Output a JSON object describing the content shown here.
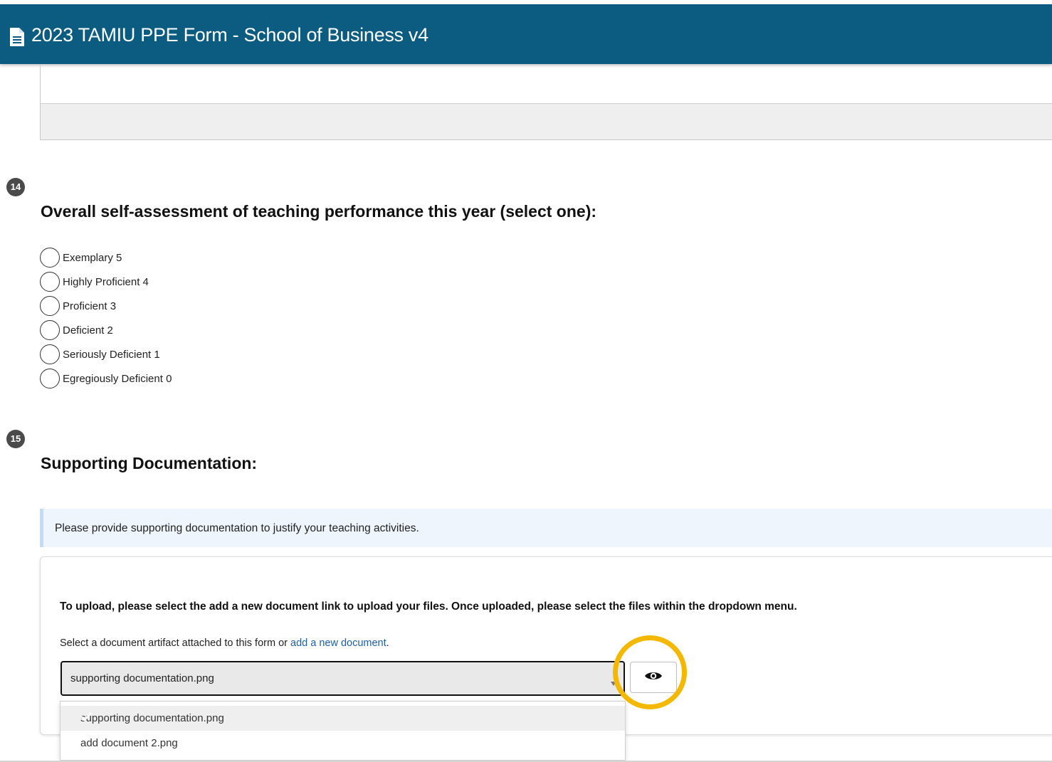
{
  "header": {
    "title": "2023 TAMIU PPE Form - School of Business v4",
    "icon": "document-icon"
  },
  "colors": {
    "header_bg": "#0b5c80",
    "highlight_ring": "#f5b800",
    "link": "#1f5fa6",
    "info_bg": "#eef5fd"
  },
  "questions": {
    "q14": {
      "number": "14",
      "title": "Overall self-assessment of teaching performance this year (select one):",
      "options": [
        "Exemplary 5",
        "Highly Proficient 4",
        "Proficient 3",
        "Deficient 2",
        "Seriously Deficient 1",
        "Egregiously Deficient 0"
      ]
    },
    "q15": {
      "number": "15",
      "title": "Supporting Documentation:",
      "info": "Please provide supporting documentation to justify your teaching activities.",
      "instructions": "To upload, please select the add a new document link to upload your files. Once uploaded, please select the files within the dropdown menu.",
      "select_label": "Select a document artifact attached to this form or ",
      "add_link": "add a new document",
      "select_label_end": ".",
      "selected_value": "supporting documentation.png",
      "dropdown_options": [
        "supporting documentation.png",
        "add document 2.png"
      ]
    }
  }
}
